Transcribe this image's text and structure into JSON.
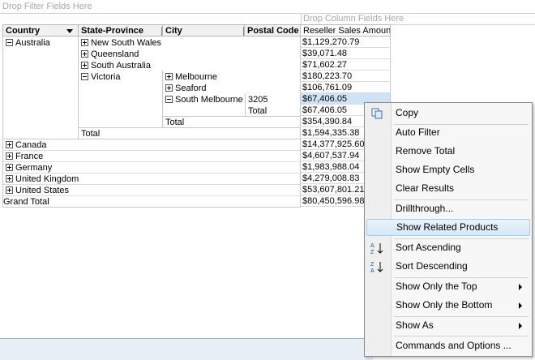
{
  "pivot": {
    "drop_filter_text": "Drop Filter Fields Here",
    "drop_column_text": "Drop Column Fields Here",
    "headers": {
      "country": "Country",
      "state": "State-Province",
      "city": "City",
      "postal": "Postal Code",
      "measure": "Reseller Sales Amount"
    },
    "australia": "Australia",
    "states": {
      "nsw": "New South Wales",
      "qld": "Queensland",
      "sa": "South Australia",
      "vic": "Victoria"
    },
    "cities": {
      "melbourne": "Melbourne",
      "seaford": "Seaford",
      "south_melbourne": "South Melbourne"
    },
    "postal_code": "3205",
    "total_label": "Total",
    "grand_total_label": "Grand Total",
    "countries": [
      "Canada",
      "France",
      "Germany",
      "United Kingdom",
      "United States"
    ],
    "values": {
      "nsw": "$1,129,270.79",
      "qld": "$39,071.48",
      "sa": "$71,602.27",
      "melbourne": "$180,223.70",
      "seaford": "$106,761.09",
      "postal_3205": "$67,406.05",
      "postal_total": "$67,406.05",
      "victoria_total": "$354,390.84",
      "australia_total": "$1,594,335.38",
      "countries": [
        "$14,377,925.60",
        "$4,607,537.94",
        "$1,983,988.04",
        "$4,279,008.83",
        "$53,607,801.21"
      ],
      "grand_total": "$80,450,596.98"
    }
  },
  "context_menu": {
    "items": [
      {
        "label": "Copy",
        "icon": "copy-icon"
      },
      {
        "label": "Auto Filter"
      },
      {
        "label": "Remove Total"
      },
      {
        "label": "Show Empty Cells"
      },
      {
        "label": "Clear Results"
      },
      {
        "label": "Drillthrough..."
      },
      {
        "label": "Show Related Products",
        "highlighted": true
      },
      {
        "label": "Sort Ascending",
        "icon": "sort-ascending-icon"
      },
      {
        "label": "Sort Descending",
        "icon": "sort-descending-icon"
      },
      {
        "label": "Show Only the Top",
        "submenu": true
      },
      {
        "label": "Show Only the Bottom",
        "submenu": true
      },
      {
        "label": "Show As",
        "submenu": true
      },
      {
        "label": "Commands and Options ..."
      }
    ]
  },
  "colors": {
    "highlight": "#d6e8f8",
    "selected_cell": "#cfe3f7",
    "header_bg": "#f1f1f1"
  }
}
